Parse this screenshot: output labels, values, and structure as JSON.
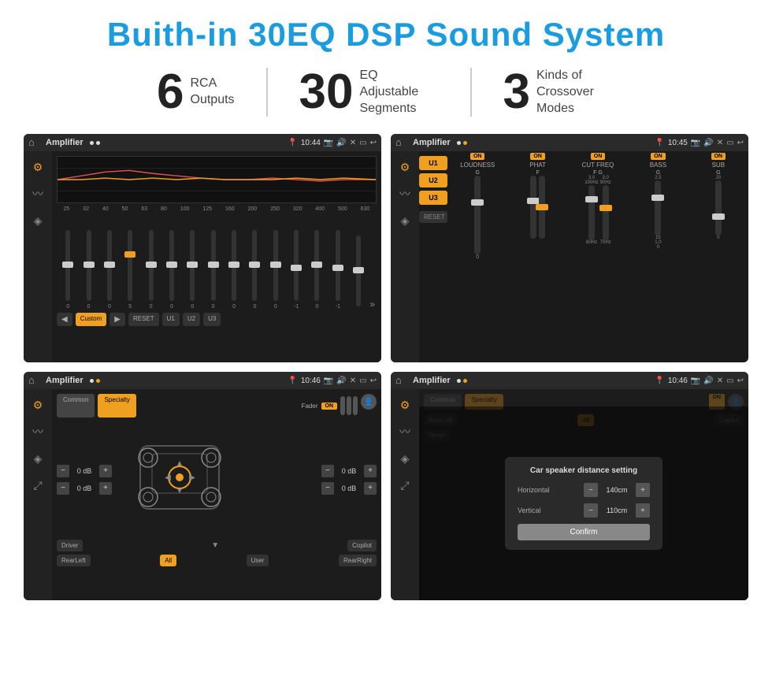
{
  "page": {
    "title": "Buith-in 30EQ DSP Sound System",
    "stats": [
      {
        "number": "6",
        "label": "RCA\nOutputs"
      },
      {
        "number": "30",
        "label": "EQ Adjustable\nSegments"
      },
      {
        "number": "3",
        "label": "Kinds of\nCrossover Modes"
      }
    ],
    "screens": [
      {
        "id": "eq-screen",
        "time": "10:44",
        "app": "Amplifier",
        "eq_freqs": [
          "25",
          "32",
          "40",
          "50",
          "63",
          "80",
          "100",
          "125",
          "160",
          "200",
          "250",
          "320",
          "400",
          "500",
          "630"
        ],
        "eq_values": [
          "0",
          "0",
          "0",
          "5",
          "0",
          "0",
          "0",
          "0",
          "0",
          "0",
          "0",
          "-1",
          "0",
          "-1",
          ""
        ],
        "buttons": [
          "Custom",
          "RESET",
          "U1",
          "U2",
          "U3"
        ]
      },
      {
        "id": "crossover-screen",
        "time": "10:45",
        "app": "Amplifier",
        "presets": [
          "U1",
          "U2",
          "U3"
        ],
        "channels": [
          "LOUDNESS",
          "PHAT",
          "CUT FREQ",
          "BASS",
          "SUB"
        ],
        "channel_labels": [
          "G",
          "F",
          "F G",
          "G"
        ]
      },
      {
        "id": "fader-screen",
        "time": "10:46",
        "app": "Amplifier",
        "tabs": [
          "Common",
          "Specialty"
        ],
        "fader_label": "Fader",
        "fader_on": "ON",
        "vol_values": [
          "0 dB",
          "0 dB",
          "0 dB",
          "0 dB"
        ],
        "bottom_labels": [
          "Driver",
          "All",
          "User",
          "RearRight"
        ],
        "rear_labels": [
          "RearLeft",
          "Copilot"
        ]
      },
      {
        "id": "dialog-screen",
        "time": "10:46",
        "app": "Amplifier",
        "tabs": [
          "Common",
          "Specialty"
        ],
        "dialog": {
          "title": "Car speaker distance setting",
          "horizontal_label": "Horizontal",
          "horizontal_value": "140cm",
          "vertical_label": "Vertical",
          "vertical_value": "110cm",
          "confirm_label": "Confirm"
        },
        "rear_labels": [
          "RearLeft",
          "All",
          "Copilot"
        ],
        "driver_label": "Driver"
      }
    ]
  }
}
